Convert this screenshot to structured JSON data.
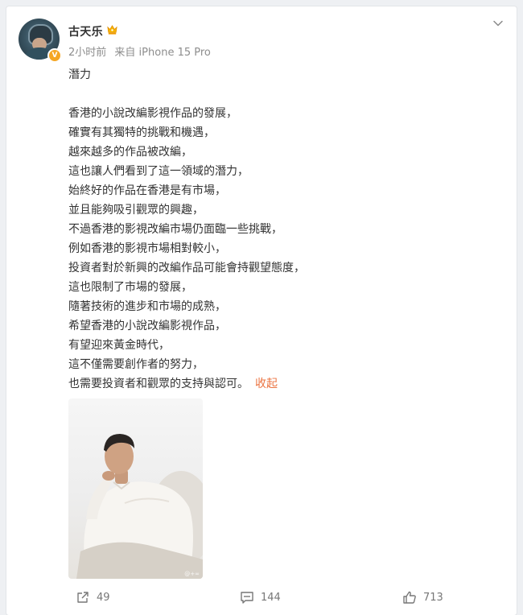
{
  "user": {
    "name": "古天乐",
    "avatar_badge": "V",
    "badge_color": "#f5a623"
  },
  "meta": {
    "time": "2小时前",
    "source": "来自 iPhone 15 Pro"
  },
  "post": {
    "title": "潛力",
    "lines": [
      "香港的小說改編影視作品的發展，",
      "確實有其獨特的挑戰和機遇，",
      "越來越多的作品被改編，",
      "這也讓人們看到了這一領域的潛力，",
      "始終好的作品在香港是有市場，",
      "並且能夠吸引觀眾的興趣，",
      "不過香港的影視改編市場仍面臨一些挑戰，",
      "例如香港的影視市場相對較小，",
      "投資者對於新興的改編作品可能會持觀望態度，",
      "這也限制了市場的發展，",
      "隨著技術的進步和市場的成熟，",
      "希望香港的小說改編影視作品，",
      "有望迎來黃金時代，",
      "這不僅需要創作者的努力，",
      "也需要投資者和觀眾的支持與認可。"
    ],
    "collapse_label": "收起",
    "collapse_color": "#eb7340"
  },
  "photo": {
    "watermark": "@+∞"
  },
  "actions": {
    "repost_count": "49",
    "comment_count": "144",
    "like_count": "713"
  },
  "icons": {
    "crown": "crown-icon",
    "menu": "chevron-down-icon",
    "repost": "share-icon",
    "comment": "comment-icon",
    "like": "thumbs-up-icon"
  }
}
